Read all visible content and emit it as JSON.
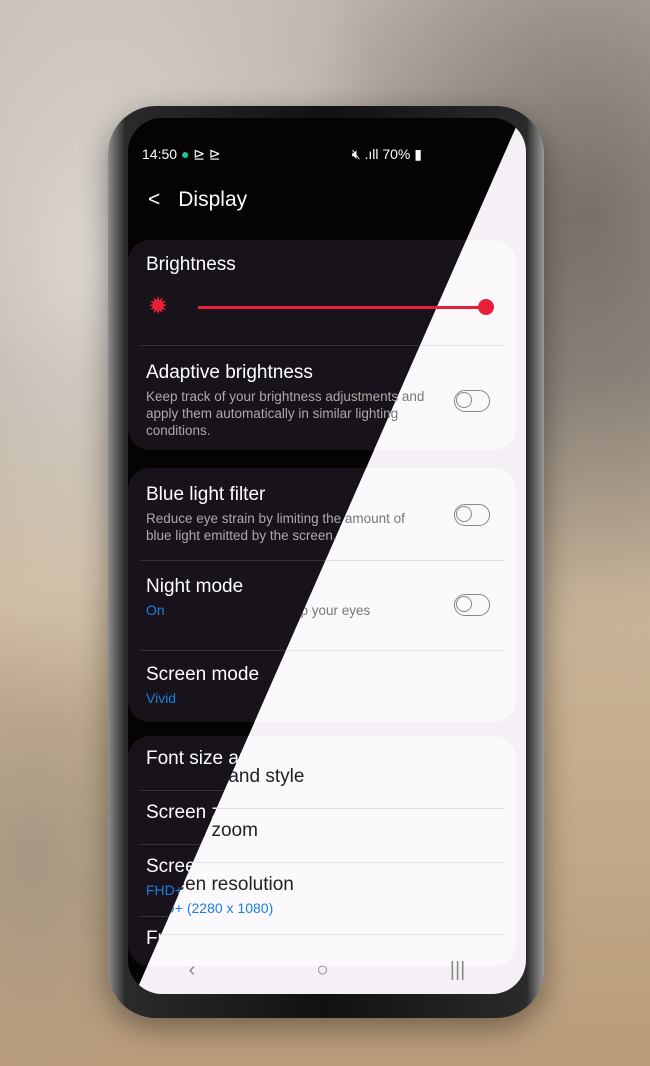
{
  "status_bar": {
    "time": "14:50",
    "battery": "70%",
    "icons": [
      "notification-app-icon",
      "play-store-icon",
      "play-store-icon",
      "mute-icon",
      "wifi-icon",
      "signal-icon",
      "battery-icon"
    ]
  },
  "header": {
    "back_icon": "chevron-left-icon",
    "title": "Display"
  },
  "brightness": {
    "title": "Brightness",
    "level_percent": 100,
    "icon": "sun-icon"
  },
  "adaptive": {
    "title": "Adaptive brightness",
    "subtitle": "Keep track of your brightness adjustments and apply them automatically in similar lighting conditions.",
    "enabled": false
  },
  "blue_light": {
    "title": "Blue light filter",
    "subtitle": "Reduce eye strain by limiting the amount of blue light emitted by the screen.",
    "enabled": false
  },
  "night_mode": {
    "title": "Night mode",
    "value": "On",
    "subtitle_fragment": "ep your eyes",
    "enabled": false
  },
  "screen_mode": {
    "title": "Screen mode",
    "value": "Vivid"
  },
  "font": {
    "title": "Font size and style"
  },
  "zoom": {
    "title": "Screen zoom"
  },
  "resolution": {
    "title": "Screen resolution",
    "value_dark": "FHD+",
    "value_light": "FHD+ (2280 x 1080)"
  },
  "full": {
    "title": "Fu"
  },
  "nav": {
    "back": "‹",
    "home": "○",
    "recents": "|||"
  },
  "colors": {
    "accent": "#e8203a",
    "link": "#1a7fe0",
    "dark_bg": "#050304",
    "light_bg": "#f4f0f6"
  }
}
